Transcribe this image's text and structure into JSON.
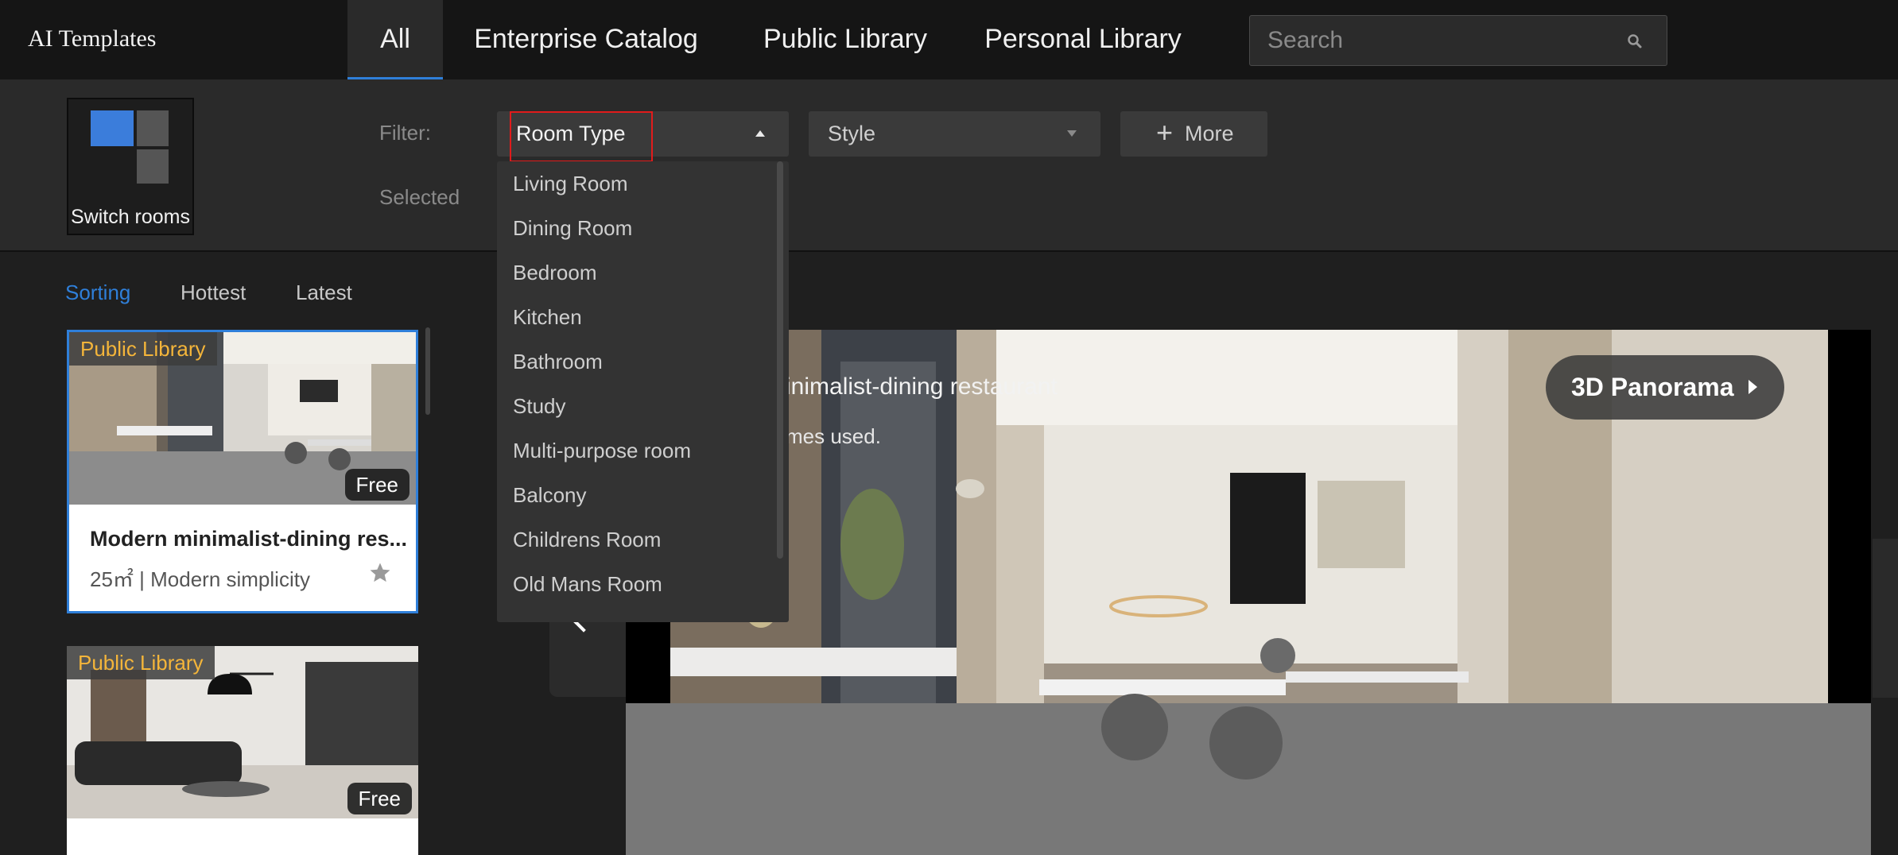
{
  "app": {
    "title": "AI Templates"
  },
  "tabs": [
    {
      "label": "All",
      "active": true
    },
    {
      "label": "Enterprise Catalog",
      "active": false
    },
    {
      "label": "Public Library",
      "active": false
    },
    {
      "label": "Personal Library",
      "active": false
    }
  ],
  "search": {
    "placeholder": "Search",
    "value": ""
  },
  "switch_rooms": {
    "label": "Switch rooms"
  },
  "filter": {
    "label": "Filter:",
    "selected_label": "Selected",
    "room_type": {
      "label": "Room Type",
      "open": true
    },
    "style": {
      "label": "Style"
    },
    "more": {
      "label": "More",
      "icon": "plus-icon"
    }
  },
  "room_type_options": [
    "Living Room",
    "Dining Room",
    "Bedroom",
    "Kitchen",
    "Bathroom",
    "Study",
    "Multi-purpose room",
    "Balcony",
    "Childrens Room",
    "Old Mans Room"
  ],
  "sorting": {
    "label": "Sorting",
    "options": [
      "Hottest",
      "Latest"
    ]
  },
  "templates": [
    {
      "tag": "Public Library",
      "price": "Free",
      "title": "Modern minimalist-dining res...",
      "meta": "25㎡ | Modern simplicity",
      "selected": true
    },
    {
      "tag": "Public Library",
      "price": "Free",
      "title": "",
      "meta": "",
      "selected": false
    }
  ],
  "preview": {
    "title": "inimalist-dining restaurant",
    "usage": "mes used.",
    "panorama_label": "3D Panorama"
  },
  "colors": {
    "accent": "#2f7fd9",
    "highlight": "#e11b1b",
    "tag": "#f4b53a"
  }
}
